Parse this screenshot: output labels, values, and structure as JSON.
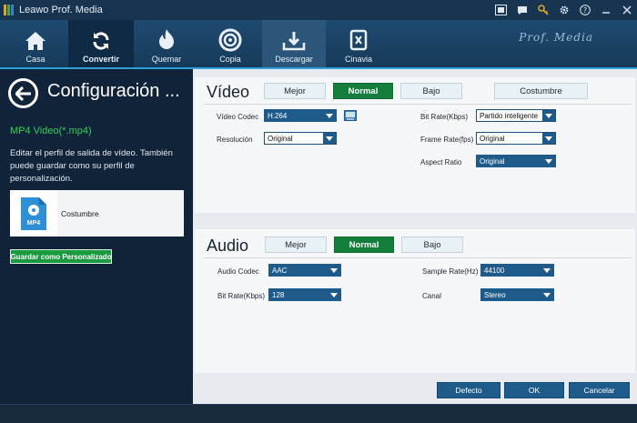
{
  "window": {
    "title": "Leawo Prof. Media",
    "logo_colors": [
      "#e2a523",
      "#4da64d",
      "#3a82c8"
    ]
  },
  "nav": {
    "brand": "Prof. Media",
    "items": [
      {
        "label": "Casa",
        "icon": "home-icon"
      },
      {
        "label": "Convertir",
        "icon": "convert-icon"
      },
      {
        "label": "Quemar",
        "icon": "burn-icon"
      },
      {
        "label": "Copia",
        "icon": "copy-disc-icon"
      },
      {
        "label": "Descargar",
        "icon": "download-icon"
      },
      {
        "label": "Cinavia",
        "icon": "cinavia-icon"
      }
    ],
    "active": "Convertir"
  },
  "left": {
    "title": "Configuración ...",
    "format_name": "MP4 Video(*.mp4)",
    "description": "Editar el perfil de salida de vídeo. También puede guardar como su perfil de personalización.",
    "profile": {
      "thumb_label": "MP4",
      "name": "Costumbre"
    },
    "save_label": "Guardar como Personalizado"
  },
  "video": {
    "title": "Vídeo",
    "presets": [
      "Mejor",
      "Normal",
      "Bajo",
      "Costumbre"
    ],
    "selected_preset": "Normal",
    "fields": {
      "codec": {
        "label": "Vídeo Codec",
        "value": "H.264"
      },
      "resolution": {
        "label": "Resolución",
        "value": "Original"
      },
      "bitrate": {
        "label": "Bit Rate(Kbps)",
        "value": "Partido inteligente"
      },
      "framerate": {
        "label": "Frame Rate(fps)",
        "value": "Original"
      },
      "aspect": {
        "label": "Aspect Ratio",
        "value": "Original"
      }
    }
  },
  "audio": {
    "title": "Audio",
    "presets": [
      "Mejor",
      "Normal",
      "Bajo"
    ],
    "selected_preset": "Normal",
    "fields": {
      "codec": {
        "label": "Audio Codec",
        "value": "AAC"
      },
      "bitrate": {
        "label": "Bit Rate(Kbps)",
        "value": "128"
      },
      "samplerate": {
        "label": "Sample Rate(Hz)",
        "value": "44100"
      },
      "channel": {
        "label": "Canal",
        "value": "Stereo"
      }
    }
  },
  "footer": {
    "default_label": "Defecto",
    "ok_label": "OK",
    "cancel_label": "Cancelar"
  },
  "colors": {
    "accent_green": "#147e3c",
    "accent_blue": "#1e5b8a",
    "format_green": "#33d05a"
  }
}
